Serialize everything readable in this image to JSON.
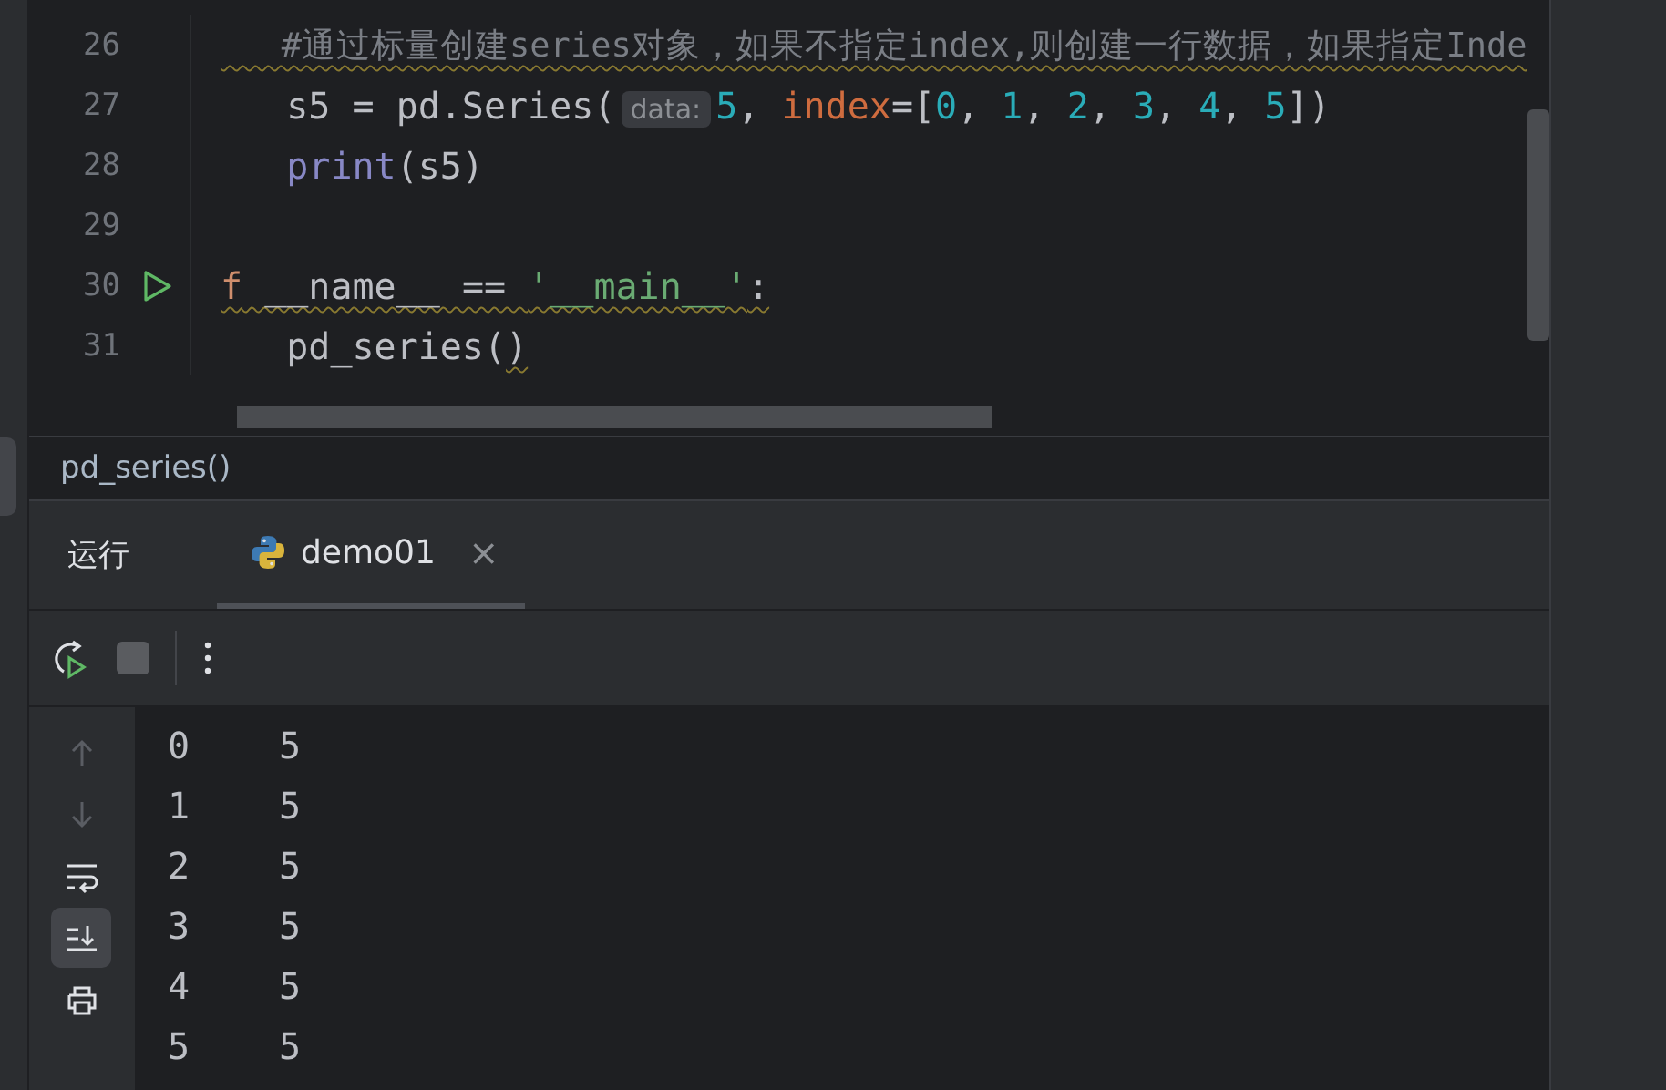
{
  "editor": {
    "lines": [
      {
        "number": "26",
        "tokens": [
          {
            "text": "   #通过标量创建series对象，如果不指定index,则创建一行数据，如果指定Inde",
            "kind": "comment",
            "squiggle": true
          }
        ]
      },
      {
        "number": "27",
        "tokens": [
          {
            "text": "   s5 = pd.Series(",
            "kind": "plain"
          },
          {
            "text": "data:",
            "kind": "hint"
          },
          {
            "text": "5",
            "kind": "number"
          },
          {
            "text": ", ",
            "kind": "plain"
          },
          {
            "text": "index",
            "kind": "param"
          },
          {
            "text": "=[",
            "kind": "plain"
          },
          {
            "text": "0",
            "kind": "number"
          },
          {
            "text": ", ",
            "kind": "plain"
          },
          {
            "text": "1",
            "kind": "number"
          },
          {
            "text": ", ",
            "kind": "plain"
          },
          {
            "text": "2",
            "kind": "number"
          },
          {
            "text": ", ",
            "kind": "plain"
          },
          {
            "text": "3",
            "kind": "number"
          },
          {
            "text": ", ",
            "kind": "plain"
          },
          {
            "text": "4",
            "kind": "number"
          },
          {
            "text": ", ",
            "kind": "plain"
          },
          {
            "text": "5",
            "kind": "number"
          },
          {
            "text": "])",
            "kind": "plain"
          }
        ]
      },
      {
        "number": "28",
        "tokens": [
          {
            "text": "   print",
            "kind": "builtin"
          },
          {
            "text": "(s5)",
            "kind": "plain"
          }
        ]
      },
      {
        "number": "29"
      },
      {
        "number": "30",
        "run_icon": true,
        "tokens": [
          {
            "text": "f",
            "kind": "keyword",
            "squiggle": true
          },
          {
            "text": " __name__ == ",
            "kind": "plain",
            "squiggle": true
          },
          {
            "text": "'__main__'",
            "kind": "string",
            "squiggle": true
          },
          {
            "text": ":",
            "kind": "plain",
            "squiggle": true
          }
        ]
      },
      {
        "number": "31",
        "tokens": [
          {
            "text": "   pd_series(",
            "kind": "plain"
          },
          {
            "text": ")",
            "kind": "plain",
            "squiggle": true
          }
        ]
      }
    ]
  },
  "breadcrumb": "pd_series()",
  "run_panel": {
    "title": "运行",
    "tabs": [
      {
        "label": "demo01",
        "selected": true,
        "close": "×"
      }
    ],
    "output": [
      {
        "index": "0",
        "value": "5"
      },
      {
        "index": "1",
        "value": "5"
      },
      {
        "index": "2",
        "value": "5"
      },
      {
        "index": "3",
        "value": "5"
      },
      {
        "index": "4",
        "value": "5"
      },
      {
        "index": "5",
        "value": "5"
      }
    ],
    "side_tools": [
      {
        "kind": "up",
        "disabled": true,
        "selected": false
      },
      {
        "kind": "down",
        "disabled": true,
        "selected": false
      },
      {
        "kind": "wrap",
        "disabled": false,
        "selected": false
      },
      {
        "kind": "scroll-end",
        "disabled": false,
        "selected": true
      },
      {
        "kind": "print",
        "disabled": false,
        "selected": false
      }
    ]
  }
}
